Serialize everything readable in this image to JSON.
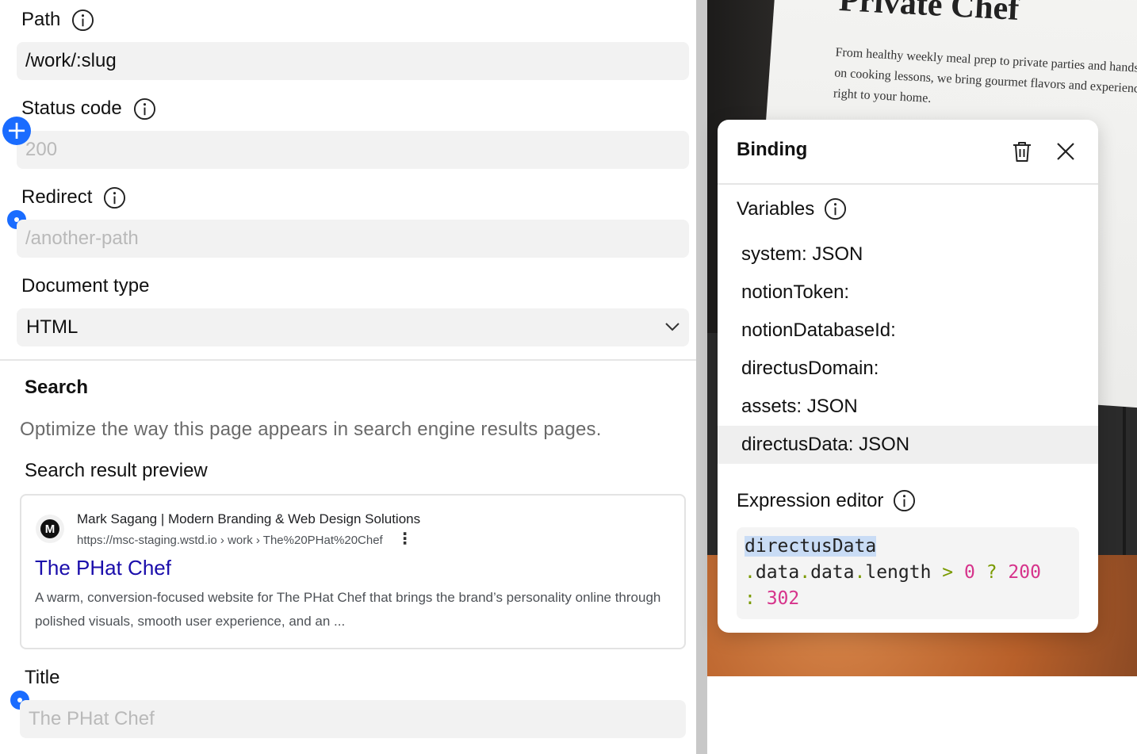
{
  "settings": {
    "path": {
      "label": "Path",
      "value": "/work/:slug"
    },
    "status_code": {
      "label": "Status code",
      "placeholder": "200"
    },
    "redirect": {
      "label": "Redirect",
      "placeholder": "/another-path"
    },
    "document_type": {
      "label": "Document type",
      "selected": "HTML"
    }
  },
  "search": {
    "title": "Search",
    "description": "Optimize the way this page appears in search engine results pages.",
    "preview_label": "Search result preview",
    "preview": {
      "favicon_letter": "M",
      "site_name": "Mark Sagang | Modern Branding & Web Design Solutions",
      "url": "https://msc-staging.wstd.io › work › The%20PHat%20Chef",
      "title": "The PHat Chef",
      "description": "A warm, conversion-focused website for The PHat Chef that brings the brand’s personality online through polished visuals, smooth user experience, and an ..."
    },
    "title_field": {
      "label": "Title",
      "placeholder": "The PHat Chef"
    }
  },
  "canvas": {
    "photo_heading": "Private Chef",
    "photo_text": "From healthy weekly meal prep to private parties and hands-on cooking lessons, we bring gourmet flavors and experiences right to your home."
  },
  "binding": {
    "title": "Binding",
    "variables_label": "Variables",
    "variables": [
      {
        "label": "system: JSON",
        "hover": false
      },
      {
        "label": "notionToken:",
        "hover": false
      },
      {
        "label": "notionDatabaseId:",
        "hover": false
      },
      {
        "label": "directusDomain:",
        "hover": false
      },
      {
        "label": "assets: JSON",
        "hover": false
      },
      {
        "label": "directusData: JSON",
        "hover": true
      }
    ],
    "expression_label": "Expression editor",
    "expression": {
      "ident": "directusData",
      "dot1": ".",
      "prop1": "data",
      "dot2": ".",
      "prop2": "data",
      "dot3": ".",
      "prop3": "length",
      "gt": " > ",
      "zero": "0",
      "q": " ? ",
      "v200": "200",
      "colon": ": ",
      "v302": "302"
    }
  },
  "colors": {
    "accent": "#1a6cff",
    "link": "#1a0dab",
    "code_number": "#d6338b",
    "code_punct": "#7a9a00"
  }
}
